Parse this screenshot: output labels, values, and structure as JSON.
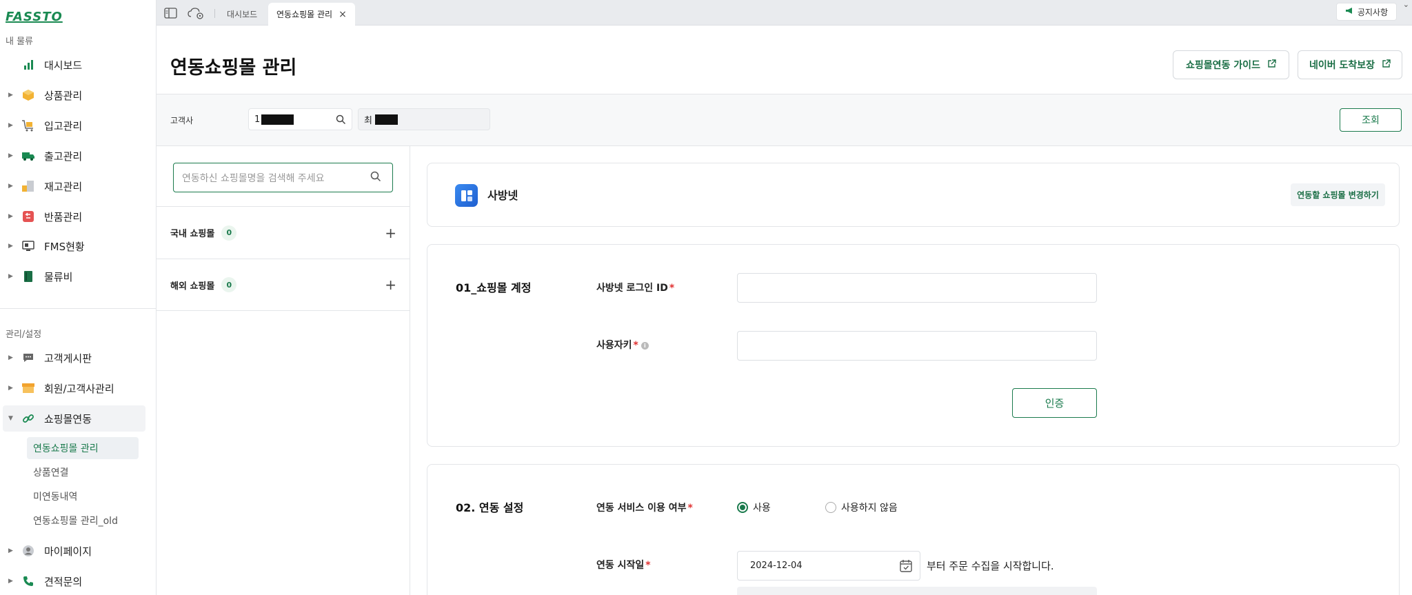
{
  "brand": {
    "logo_text": "FASSTO"
  },
  "sidebar": {
    "section_my": "내 물류",
    "section_admin": "관리/설정",
    "items": [
      {
        "label": "대시보드"
      },
      {
        "label": "상품관리"
      },
      {
        "label": "입고관리"
      },
      {
        "label": "출고관리"
      },
      {
        "label": "재고관리"
      },
      {
        "label": "반품관리"
      },
      {
        "label": "FMS현황"
      },
      {
        "label": "물류비"
      }
    ],
    "admin_items": [
      {
        "label": "고객게시판"
      },
      {
        "label": "회원/고객사관리"
      },
      {
        "label": "쇼핑몰연동"
      },
      {
        "label": "마이페이지"
      },
      {
        "label": "견적문의"
      }
    ],
    "sub_items": [
      {
        "label": "연동쇼핑몰 관리"
      },
      {
        "label": "상품연결"
      },
      {
        "label": "미연동내역"
      },
      {
        "label": "연동쇼핑몰 관리_old"
      }
    ]
  },
  "tabs": {
    "dashboard": "대시보드",
    "active": "연동쇼핑몰 관리",
    "close": "×"
  },
  "notice": {
    "label": "공지사항"
  },
  "header": {
    "title": "연동쇼핑몰 관리",
    "guide_button": "쇼핑몰연동 가이드",
    "naver_button": "네이버 도착보장"
  },
  "filter": {
    "label": "고객사",
    "customer_code": "1",
    "customer_name": "최",
    "search_button": "조회"
  },
  "list": {
    "search_placeholder": "연동하신 쇼핑몰명을 검색해 주세요",
    "groups": [
      {
        "label": "국내 쇼핑몰",
        "count": "0"
      },
      {
        "label": "해외 쇼핑몰",
        "count": "0"
      }
    ],
    "plus": "+"
  },
  "mall": {
    "name": "사방넷",
    "change_button": "연동할 쇼핑몰 변경하기"
  },
  "account_section": {
    "title": "01_쇼핑몰 계정",
    "login_id_label": "사방넷 로그인 ID",
    "user_key_label": "사용자키",
    "required_mark": "*",
    "info_mark": "i",
    "auth_button": "인증"
  },
  "settings_section": {
    "title": "02. 연동 설정",
    "service_label": "연동 서비스 이용 여부",
    "option_use": "사용",
    "option_not_use": "사용하지 않음",
    "selected": "사용",
    "start_date_label": "연동 시작일",
    "start_date": "2024-12-04",
    "start_date_suffix": "부터 주문 수집을 시작합니다."
  },
  "colors": {
    "accent": "#1a7a4c",
    "required": "#e03131"
  }
}
